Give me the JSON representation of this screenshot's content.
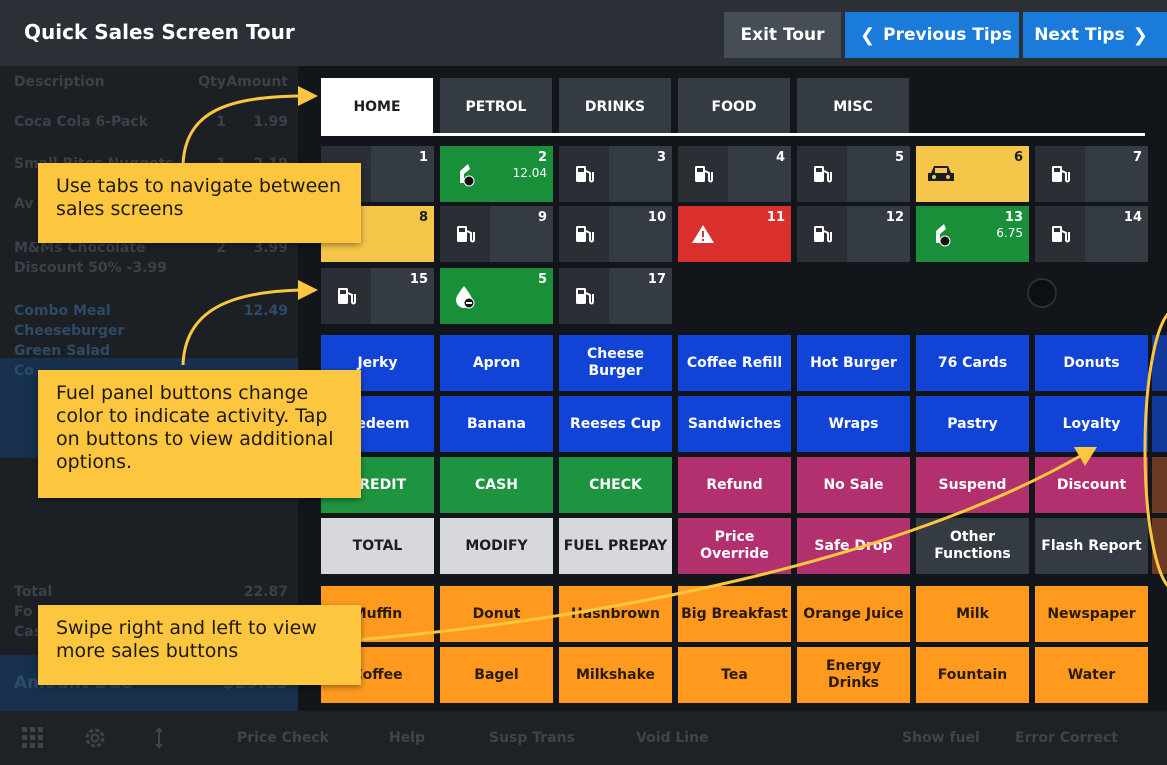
{
  "header": {
    "title": "Quick Sales Screen Tour",
    "exit_label": "Exit Tour",
    "prev_label": "Previous Tips",
    "next_label": "Next Tips"
  },
  "transaction": {
    "col_description": "Description",
    "col_qty": "Qty",
    "col_amount": "Amount",
    "items": [
      {
        "desc": "Coca Cola 6-Pack",
        "qty": "1",
        "amount": "1.99"
      },
      {
        "desc": "Small Bites Nuggets",
        "qty": "1",
        "amount": "2.19"
      },
      {
        "desc": "Av",
        "qty": "",
        "amount": ""
      },
      {
        "desc": "M&Ms Chocolate",
        "qty": "2",
        "amount": "3.99"
      }
    ],
    "discount": "Discount 50% -3.99",
    "combo": {
      "name": "Combo Meal",
      "amount": "12.49",
      "lines": [
        "Cheeseburger",
        "Green Salad",
        "Co"
      ]
    },
    "total_label": "Total",
    "total_value": "22.87",
    "sub1": "Fo",
    "sub2": "Cas",
    "amount_due_label": "Amount Due",
    "amount_due_value": "$15.23"
  },
  "tabs": [
    "HOME",
    "PETROL",
    "DRINKS",
    "FOOD",
    "MISC"
  ],
  "pumps": [
    {
      "num": "1",
      "state": "grey",
      "icon": "fuel-pump-icon",
      "amount": ""
    },
    {
      "num": "2",
      "state": "green",
      "icon": "fuel-nozzle-icon",
      "amount": "12.04"
    },
    {
      "num": "3",
      "state": "grey",
      "icon": "fuel-pump-icon",
      "amount": ""
    },
    {
      "num": "4",
      "state": "grey",
      "icon": "fuel-pump-icon",
      "amount": ""
    },
    {
      "num": "5",
      "state": "grey",
      "icon": "fuel-pump-icon",
      "amount": ""
    },
    {
      "num": "6",
      "state": "yellow",
      "icon": "car-icon",
      "amount": ""
    },
    {
      "num": "7",
      "state": "grey",
      "icon": "fuel-pump-icon",
      "amount": ""
    },
    {
      "num": "8",
      "state": "yellow",
      "icon": "fuel-pump-icon",
      "amount": ""
    },
    {
      "num": "9",
      "state": "grey",
      "icon": "fuel-pump-icon",
      "amount": ""
    },
    {
      "num": "10",
      "state": "grey",
      "icon": "fuel-pump-icon",
      "amount": ""
    },
    {
      "num": "11",
      "state": "red",
      "icon": "warning-icon",
      "amount": ""
    },
    {
      "num": "12",
      "state": "grey",
      "icon": "fuel-pump-icon",
      "amount": ""
    },
    {
      "num": "13",
      "state": "green",
      "icon": "fuel-nozzle-icon",
      "amount": "6.75"
    },
    {
      "num": "14",
      "state": "grey",
      "icon": "fuel-pump-icon",
      "amount": ""
    },
    {
      "num": "15",
      "state": "grey",
      "icon": "fuel-pump-icon",
      "amount": ""
    },
    {
      "num": "5",
      "state": "green",
      "icon": "fuel-drop-icon",
      "amount": ""
    },
    {
      "num": "17",
      "state": "grey",
      "icon": "fuel-pump-icon",
      "amount": ""
    }
  ],
  "sales_rows": [
    [
      {
        "l": "Jerky",
        "c": "blue"
      },
      {
        "l": "Apron",
        "c": "blue"
      },
      {
        "l": "Cheese Burger",
        "c": "blue"
      },
      {
        "l": "Coffee Refill",
        "c": "blue"
      },
      {
        "l": "Hot Burger",
        "c": "blue"
      },
      {
        "l": "76 Cards",
        "c": "blue"
      },
      {
        "l": "Donuts",
        "c": "blue"
      }
    ],
    [
      {
        "l": "Redeem",
        "c": "blue"
      },
      {
        "l": "Banana",
        "c": "blue"
      },
      {
        "l": "Reeses Cup",
        "c": "blue"
      },
      {
        "l": "Sandwiches",
        "c": "blue"
      },
      {
        "l": "Wraps",
        "c": "blue"
      },
      {
        "l": "Pastry",
        "c": "blue"
      },
      {
        "l": "Loyalty",
        "c": "blue"
      }
    ],
    [
      {
        "l": "CREDIT",
        "c": "green2"
      },
      {
        "l": "CASH",
        "c": "green2"
      },
      {
        "l": "CHECK",
        "c": "green2"
      },
      {
        "l": "Refund",
        "c": "magenta"
      },
      {
        "l": "No Sale",
        "c": "magenta"
      },
      {
        "l": "Suspend",
        "c": "magenta"
      },
      {
        "l": "Discount",
        "c": "magenta"
      }
    ],
    [
      {
        "l": "TOTAL",
        "c": "lgrey"
      },
      {
        "l": "MODIFY",
        "c": "lgrey"
      },
      {
        "l": "FUEL PREPAY",
        "c": "lgrey"
      },
      {
        "l": "Price Override",
        "c": "magenta"
      },
      {
        "l": "Safe Drop",
        "c": "magenta"
      },
      {
        "l": "Other Functions",
        "c": "dgrey"
      },
      {
        "l": "Flash Report",
        "c": "dgrey"
      }
    ],
    [
      {
        "l": "Muffin",
        "c": "orange"
      },
      {
        "l": "Donut",
        "c": "orange"
      },
      {
        "l": "Hashbrown",
        "c": "orange"
      },
      {
        "l": "Big Breakfast",
        "c": "orange"
      },
      {
        "l": "Orange Juice",
        "c": "orange"
      },
      {
        "l": "Milk",
        "c": "orange"
      },
      {
        "l": "Newspaper",
        "c": "orange"
      }
    ],
    [
      {
        "l": "Coffee",
        "c": "orange"
      },
      {
        "l": "Bagel",
        "c": "orange"
      },
      {
        "l": "Milkshake",
        "c": "orange"
      },
      {
        "l": "Tea",
        "c": "orange"
      },
      {
        "l": "Energy Drinks",
        "c": "orange"
      },
      {
        "l": "Fountain",
        "c": "orange"
      },
      {
        "l": "Water",
        "c": "orange"
      }
    ]
  ],
  "footer": {
    "icons": [
      "grid-icon",
      "gear-icon",
      "resize-arrows-icon"
    ],
    "actions": [
      "Price Check",
      "Help",
      "Susp Trans",
      "Void Line",
      "Show fuel",
      "Error Correct"
    ]
  },
  "callouts": {
    "tabs": "Use tabs to navigate between sales screens",
    "fuel": "Fuel panel buttons change color to indicate activity. Tap on buttons to view additional options.",
    "swipe": "Swipe right and left to view more sales buttons"
  },
  "colors": {
    "accent_blue": "#1a7bdb",
    "callout": "#fcc63e",
    "pump_green": "#1a8f3a",
    "pump_yellow": "#f5c64a",
    "pump_red": "#d9302e"
  }
}
